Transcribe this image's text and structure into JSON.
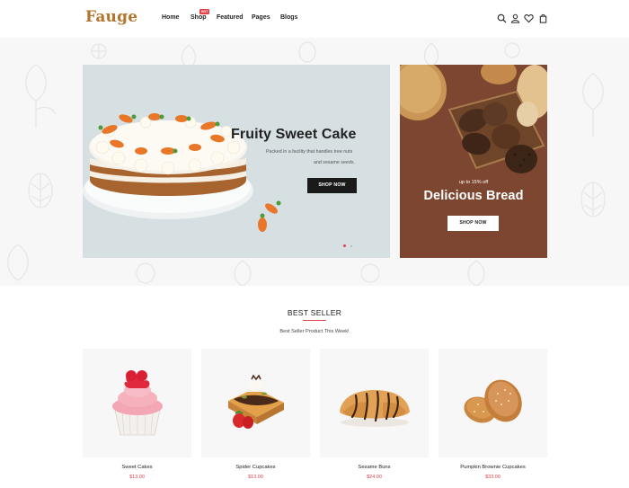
{
  "header": {
    "logo": "Fauge",
    "logo_subtitle": "",
    "nav": {
      "home": "Home",
      "shop": "Shop",
      "shop_badge": "HOT",
      "featured": "Featured",
      "pages": "Pages",
      "blogs": "Blogs"
    },
    "icons": [
      "search-icon",
      "user-icon",
      "heart-icon",
      "shopping-bag-icon"
    ]
  },
  "hero": {
    "title": "Fruity Sweet Cake",
    "description_line1": "Packed in a facility that handles tree nuts",
    "description_line2": "and sesame seeds.",
    "button": "SHOP NOW",
    "active_slide": 1,
    "slide_count": 2
  },
  "side_banner": {
    "small_text": "up to 15% off",
    "title": "Delicious Bread",
    "button": "SHOP NOW"
  },
  "best_seller": {
    "title": "BEST SELLER",
    "subtitle": "Best Seller Product This Week!",
    "products": [
      {
        "name": "Sweet Cakes",
        "price": "$13.00"
      },
      {
        "name": "Spider Cupcakes",
        "price": "$13.00"
      },
      {
        "name": "Sesame Buns",
        "price": "$24.00"
      },
      {
        "name": "Pumpkin Brownie Cupcakes",
        "price": "$33.00"
      }
    ]
  },
  "colors": {
    "accent": "#e2434b",
    "logo": "#b5742c",
    "side_banner_bg": "#7d4630",
    "slider_bg": "#d6e0e3"
  }
}
